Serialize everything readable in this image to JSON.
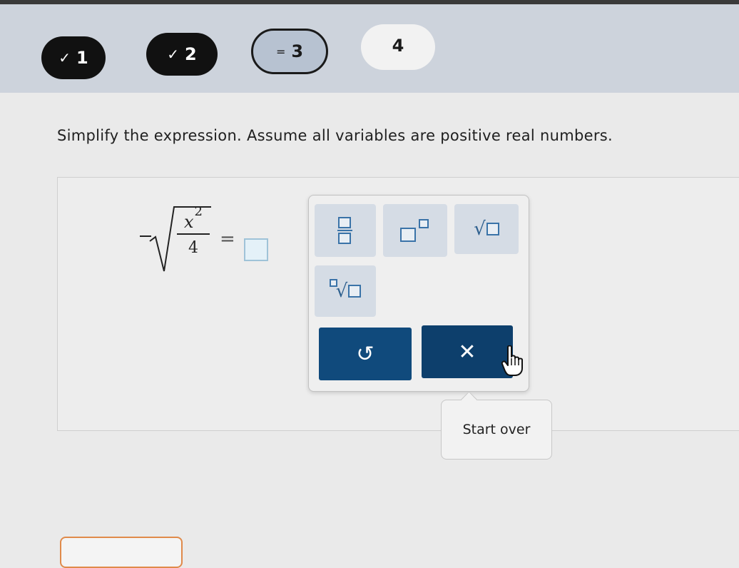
{
  "steps": [
    {
      "label": "1",
      "status": "done",
      "icon": "check-icon",
      "glyph": "✓"
    },
    {
      "label": "2",
      "status": "done",
      "icon": "check-icon",
      "glyph": "✓"
    },
    {
      "label": "3",
      "status": "current",
      "icon": "in-progress-icon",
      "glyph": "="
    },
    {
      "label": "4",
      "status": "future"
    }
  ],
  "question": {
    "prompt": "Simplify the expression. Assume all variables are positive real numbers.",
    "expression": {
      "sign": "-",
      "numerator_var": "x",
      "numerator_exp": "2",
      "denominator": "4",
      "equals": "="
    },
    "answer_value": ""
  },
  "palette": {
    "tools": [
      {
        "name": "fraction-tool",
        "icon": "fraction-icon"
      },
      {
        "name": "exponent-tool",
        "icon": "superscript-icon"
      },
      {
        "name": "square-root-tool",
        "icon": "square-root-icon",
        "glyph": "√"
      },
      {
        "name": "nth-root-tool",
        "icon": "nth-root-icon",
        "glyph": "√"
      }
    ],
    "reset_glyph": "↺",
    "clear_glyph": "✕"
  },
  "tooltip": {
    "text": "Start over"
  },
  "colors": {
    "step_done": "#111111",
    "step_current": "#b7c2d1",
    "action_button": "#104a7c",
    "tool_button": "#d5dce5",
    "answer_box_border": "#9fc3d8"
  }
}
